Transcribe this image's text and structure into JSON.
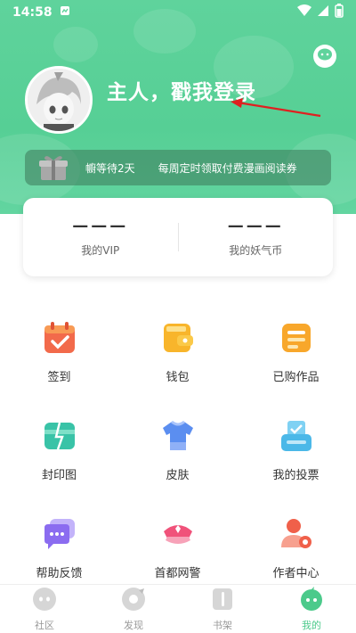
{
  "status_bar": {
    "time": "14:58"
  },
  "profile": {
    "login_text": "主人，戳我登录"
  },
  "banner": {
    "wait_text": "幮等待2天",
    "promo_text": "每周定时领取付费漫画阅读券"
  },
  "stats": [
    {
      "value": "———",
      "label": "我的VIP"
    },
    {
      "value": "———",
      "label": "我的妖气币"
    }
  ],
  "grid": [
    {
      "label": "签到",
      "icon": "calendar-check-icon",
      "color": "#f26a4b"
    },
    {
      "label": "钱包",
      "icon": "wallet-icon",
      "color": "#f8b52b"
    },
    {
      "label": "已购作品",
      "icon": "purchased-list-icon",
      "color": "#f8a72b"
    },
    {
      "label": "封印图",
      "icon": "sealed-picture-icon",
      "color": "#39c3a7"
    },
    {
      "label": "皮肤",
      "icon": "tshirt-icon",
      "color": "#5b8ef0"
    },
    {
      "label": "我的投票",
      "icon": "vote-box-icon",
      "color": "#4bb8e8"
    },
    {
      "label": "帮助反馈",
      "icon": "feedback-chat-icon",
      "color": "#8b6cf0"
    },
    {
      "label": "首都网警",
      "icon": "police-cap-icon",
      "color": "#f0527a"
    },
    {
      "label": "作者中心",
      "icon": "author-person-icon",
      "color": "#f0604a"
    }
  ],
  "tabs": [
    {
      "label": "社区",
      "icon": "community-icon"
    },
    {
      "label": "发现",
      "icon": "discover-icon"
    },
    {
      "label": "书架",
      "icon": "bookshelf-icon"
    },
    {
      "label": "我的",
      "icon": "mine-icon"
    }
  ],
  "colors": {
    "header_green": "#5fd39c",
    "active_tab": "#4cca8b"
  }
}
